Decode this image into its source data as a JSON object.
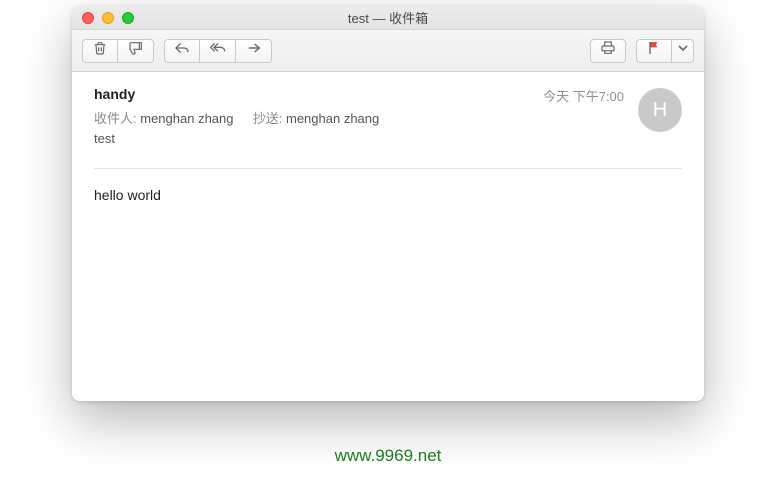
{
  "window": {
    "title": "test — 收件箱"
  },
  "email": {
    "sender": "handy",
    "timestamp": "今天 下午7:00",
    "to_label": "收件人:",
    "to_value": "menghan zhang",
    "cc_label": "抄送:",
    "cc_value": "menghan zhang",
    "subject": "test",
    "avatar_initial": "H",
    "body": "hello world"
  },
  "footer": {
    "url": "www.9969.net"
  }
}
